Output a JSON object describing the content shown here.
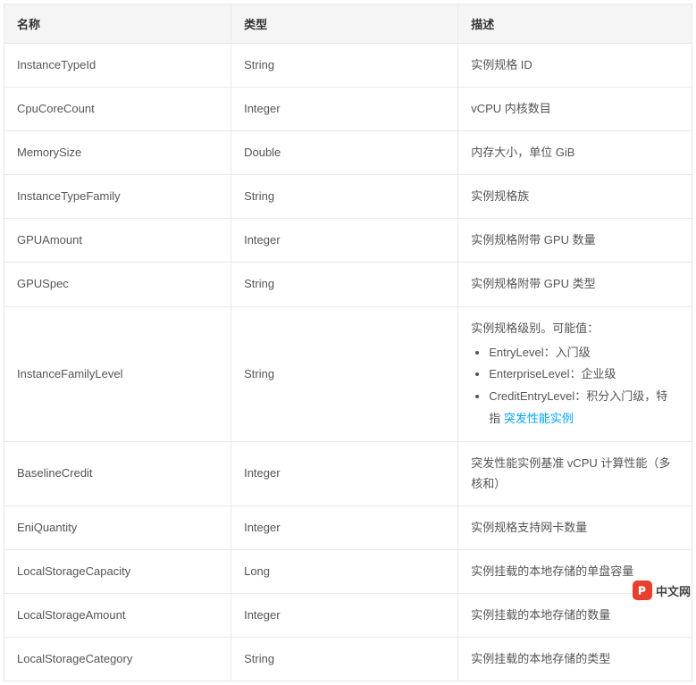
{
  "table": {
    "headers": {
      "name": "名称",
      "type": "类型",
      "desc": "描述"
    },
    "rows": [
      {
        "name": "InstanceTypeId",
        "type": "String",
        "desc": "实例规格 ID"
      },
      {
        "name": "CpuCoreCount",
        "type": "Integer",
        "desc": "vCPU 内核数目"
      },
      {
        "name": "MemorySize",
        "type": "Double",
        "desc": "内存大小，单位 GiB"
      },
      {
        "name": "InstanceTypeFamily",
        "type": "String",
        "desc": "实例规格族"
      },
      {
        "name": "GPUAmount",
        "type": "Integer",
        "desc": "实例规格附带 GPU 数量"
      },
      {
        "name": "GPUSpec",
        "type": "String",
        "desc": "实例规格附带 GPU 类型"
      }
    ],
    "complexRow": {
      "name": "InstanceFamilyLevel",
      "type": "String",
      "intro": "实例规格级别。可能值：",
      "items": [
        {
          "text": "EntryLevel：入门级"
        },
        {
          "text": "EnterpriseLevel：企业级"
        },
        {
          "prefix": "CreditEntryLevel：积分入门级，特指 ",
          "link": "突发性能实例"
        }
      ]
    },
    "rowsAfter": [
      {
        "name": "BaselineCredit",
        "type": "Integer",
        "desc": "突发性能实例基准 vCPU 计算性能（多核和）"
      },
      {
        "name": "EniQuantity",
        "type": "Integer",
        "desc": "实例规格支持网卡数量"
      },
      {
        "name": "LocalStorageCapacity",
        "type": "Long",
        "desc": "实例挂载的本地存储的单盘容量"
      },
      {
        "name": "LocalStorageAmount",
        "type": "Integer",
        "desc": "实例挂载的本地存储的数量"
      },
      {
        "name": "LocalStorageCategory",
        "type": "String",
        "desc": "实例挂载的本地存储的类型"
      }
    ]
  },
  "badge": {
    "text": "中文网"
  }
}
